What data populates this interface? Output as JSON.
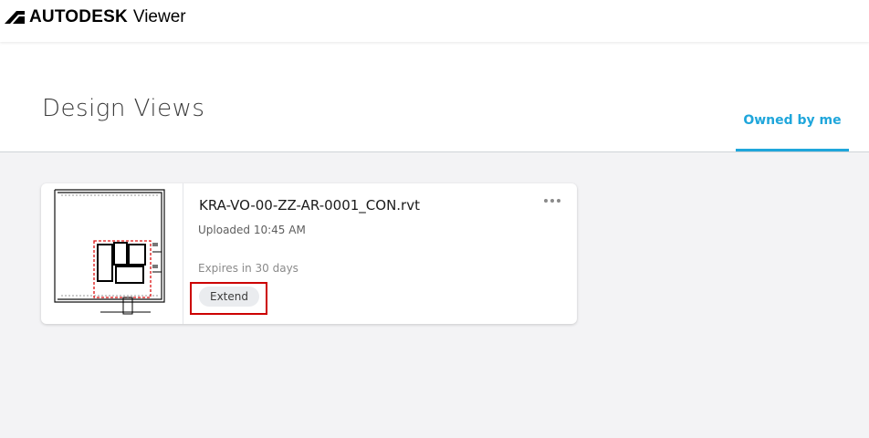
{
  "app": {
    "brand": "AUTODESK",
    "product": "Viewer",
    "logo_icon": "autodesk-a-logo-icon"
  },
  "page": {
    "title": "Design Views",
    "tabs": [
      {
        "label": "Owned by me",
        "active": true
      }
    ],
    "accent_color": "#1fa6db"
  },
  "files": [
    {
      "name": "KRA-VO-00-ZZ-AR-0001_CON.rvt",
      "uploaded": "Uploaded 10:45 AM",
      "expires": "Expires in 30 days",
      "extend_label": "Extend",
      "thumbnail_icon": "floor-plan-thumbnail",
      "menu_icon": "more-options-icon"
    }
  ]
}
